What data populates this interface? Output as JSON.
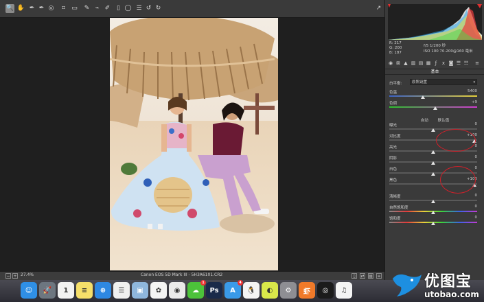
{
  "toolbar": {
    "tools": [
      {
        "icon": "zoom-icon",
        "glyph": "🔍",
        "active": true
      },
      {
        "icon": "hand-icon",
        "glyph": "✋"
      },
      {
        "icon": "white-balance-icon",
        "glyph": "✒"
      },
      {
        "icon": "color-sampler-icon",
        "glyph": "✒"
      },
      {
        "icon": "targeted-adjust-icon",
        "glyph": "◎"
      },
      {
        "icon": "crop-icon",
        "glyph": "⌗"
      },
      {
        "icon": "straighten-icon",
        "glyph": "▭"
      },
      {
        "icon": "spot-removal-icon",
        "glyph": "✎"
      },
      {
        "icon": "redeye-icon",
        "glyph": "⌁"
      },
      {
        "icon": "adjustment-brush-icon",
        "glyph": "✐"
      },
      {
        "icon": "graduated-filter-icon",
        "glyph": "▯"
      },
      {
        "icon": "radial-filter-icon",
        "glyph": "◯"
      },
      {
        "icon": "presets-icon",
        "glyph": "☰"
      },
      {
        "icon": "rotate-left-icon",
        "glyph": "↺"
      },
      {
        "icon": "rotate-right-icon",
        "glyph": "↻"
      }
    ],
    "export_icon": "↗"
  },
  "status": {
    "zoom": "27.4%",
    "camera": "Canon EOS 5D Mark III - 5H3A6101.CR2"
  },
  "panel": {
    "rgb": {
      "r": "R:  217",
      "g": "G:  200",
      "b": "B:  187"
    },
    "exif_line1": "f/5     1/200 秒",
    "exif_line2": "ISO 100    70-200@160 毫米",
    "section_title": "基本",
    "wb_label": "白平衡:",
    "wb_value": "原照设置",
    "sliders": [
      {
        "label": "色温",
        "value": "5400",
        "pos": 0.38,
        "kind": "temp"
      },
      {
        "label": "色调",
        "value": "+9",
        "pos": 0.52,
        "kind": "tint"
      },
      {
        "label": "曝光",
        "value": "0",
        "pos": 0.5,
        "kind": "plain"
      },
      {
        "label": "对比度",
        "value": "+100",
        "pos": 0.97,
        "kind": "plain"
      },
      {
        "label": "高光",
        "value": "0",
        "pos": 0.5,
        "kind": "plain"
      },
      {
        "label": "阴影",
        "value": "0",
        "pos": 0.5,
        "kind": "plain"
      },
      {
        "label": "白色",
        "value": "0",
        "pos": 0.5,
        "kind": "plain"
      },
      {
        "label": "黑色",
        "value": "+100",
        "pos": 0.97,
        "kind": "plain"
      },
      {
        "label": "清晰度",
        "value": "0",
        "pos": 0.5,
        "kind": "plain"
      },
      {
        "label": "自然饱和度",
        "value": "0",
        "pos": 0.5,
        "kind": "sat"
      },
      {
        "label": "饱和度",
        "value": "0",
        "pos": 0.5,
        "kind": "sat"
      }
    ],
    "auto_label": "自动",
    "default_label": "默认值"
  },
  "dock": {
    "apps": [
      {
        "icon": "finder-icon",
        "color": "#2f8fe6",
        "glyph": "☺"
      },
      {
        "icon": "launchpad-icon",
        "color": "#6d7680",
        "glyph": "🚀"
      },
      {
        "icon": "calendar-icon",
        "color": "#f2f2f2",
        "glyph": "1"
      },
      {
        "icon": "notes-icon",
        "color": "#f6df6a",
        "glyph": "≡"
      },
      {
        "icon": "safari-icon",
        "color": "#2e88e2",
        "glyph": "⊕"
      },
      {
        "icon": "reminders-icon",
        "color": "#f0f0f0",
        "glyph": "☰"
      },
      {
        "icon": "preview-icon",
        "color": "#8fb6dc",
        "glyph": "▣"
      },
      {
        "icon": "photos-icon",
        "color": "#f4f4f4",
        "glyph": "✿"
      },
      {
        "icon": "weibo-icon",
        "color": "#eaeaea",
        "glyph": "◉"
      },
      {
        "icon": "wechat-icon",
        "color": "#4cc23a",
        "glyph": "☁",
        "badge": "1"
      },
      {
        "icon": "photoshop-icon",
        "color": "#1a2a4a",
        "glyph": "Ps"
      },
      {
        "icon": "app-store-icon",
        "color": "#3a9ae8",
        "glyph": "A",
        "badge": "4"
      },
      {
        "icon": "qq-icon",
        "color": "#f4f4f4",
        "glyph": "🐧"
      },
      {
        "icon": "lemon-icon",
        "color": "#d9e84a",
        "glyph": "◐"
      },
      {
        "icon": "system-preferences-icon",
        "color": "#8e8e93",
        "glyph": "⚙"
      },
      {
        "icon": "xiami-icon",
        "color": "#f07a2a",
        "glyph": "虾"
      },
      {
        "icon": "terminal-icon",
        "color": "#1b1b1b",
        "glyph": "◎"
      },
      {
        "icon": "music-icon",
        "color": "#f4f4f4",
        "glyph": "♫"
      }
    ]
  },
  "watermark": {
    "title": "优图宝",
    "url": "utobao.com"
  }
}
